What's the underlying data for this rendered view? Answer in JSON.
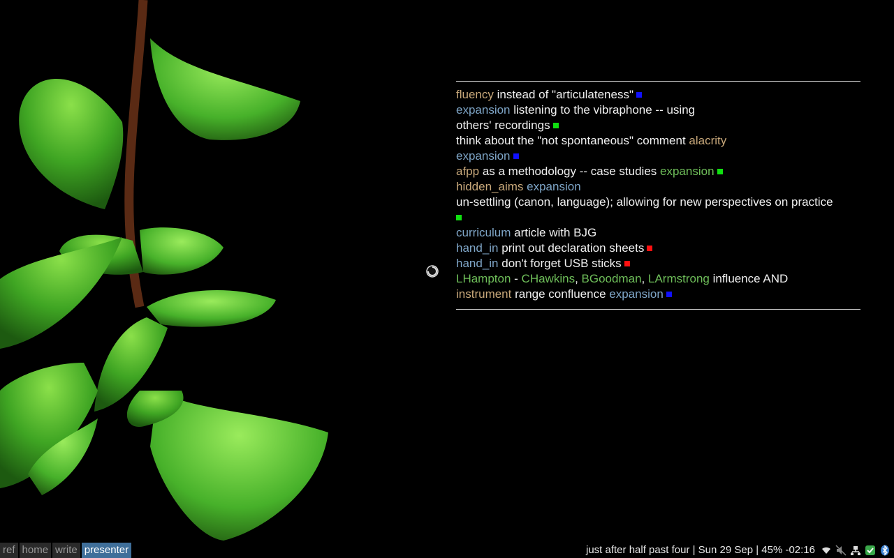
{
  "notes": [
    [
      {
        "t": "fluency",
        "c": "tag-tan"
      },
      {
        "t": " instead of \"articulateness\"",
        "c": "plain"
      },
      {
        "sq": "blue"
      }
    ],
    [
      {
        "t": "expansion",
        "c": "tag-blue"
      },
      {
        "t": " listening to the vibraphone -- using",
        "c": "plain"
      }
    ],
    [
      {
        "t": "others' recordings",
        "c": "plain"
      },
      {
        "sq": "green"
      }
    ],
    [
      {
        "t": "think about the \"not spontaneous\" comment ",
        "c": "plain"
      },
      {
        "t": "alacrity",
        "c": "tag-tan"
      }
    ],
    [
      {
        "t": "expansion",
        "c": "tag-blue"
      },
      {
        "sq": "blue"
      }
    ],
    [
      {
        "t": "afpp",
        "c": "tag-tan"
      },
      {
        "t": " as a methodology -- case studies ",
        "c": "plain"
      },
      {
        "t": "expansion",
        "c": "tag-green"
      },
      {
        "sq": "green"
      }
    ],
    [
      {
        "t": "hidden_aims",
        "c": "tag-tan"
      },
      {
        "t": " ",
        "c": "plain"
      },
      {
        "t": "expansion",
        "c": "tag-blue"
      }
    ],
    [
      {
        "t": "un-settling (canon, language); allowing for new perspectives on practice",
        "c": "plain"
      }
    ],
    [
      {
        "sq": "green",
        "nomargin": true
      }
    ],
    [
      {
        "t": "curriculum",
        "c": "tag-blue"
      },
      {
        "t": " article with BJG",
        "c": "plain"
      }
    ],
    [
      {
        "t": "hand_in",
        "c": "tag-blue"
      },
      {
        "t": " print out declaration sheets",
        "c": "plain"
      },
      {
        "sq": "red"
      }
    ],
    [
      {
        "t": "hand_in",
        "c": "tag-blue"
      },
      {
        "t": " don't forget USB sticks",
        "c": "plain"
      },
      {
        "sq": "red"
      }
    ],
    [
      {
        "t": "LHampton",
        "c": "tag-green"
      },
      {
        "t": " - ",
        "c": "plain"
      },
      {
        "t": "CHawkins",
        "c": "tag-green"
      },
      {
        "t": ", ",
        "c": "plain"
      },
      {
        "t": "BGoodman",
        "c": "tag-green"
      },
      {
        "t": ", ",
        "c": "plain"
      },
      {
        "t": "LArmstrong",
        "c": "tag-green"
      },
      {
        "t": " influence AND",
        "c": "plain"
      }
    ],
    [
      {
        "t": "instrument",
        "c": "tag-tan"
      },
      {
        "t": " range confluence ",
        "c": "plain"
      },
      {
        "t": "expansion",
        "c": "tag-blue"
      },
      {
        "sq": "blue"
      }
    ]
  ],
  "colors": {
    "plain": "#f0f0f0",
    "tag-tan": "#c8a87a",
    "tag-blue": "#7fa6c8",
    "tag-green": "#6fbf5a",
    "blue": "#1010ff",
    "green": "#10e010",
    "red": "#ff1010",
    "workspace_active": "#3f6f9a"
  },
  "workspaces": [
    {
      "label": "ref",
      "active": false
    },
    {
      "label": "home",
      "active": false
    },
    {
      "label": "write",
      "active": false
    },
    {
      "label": "presenter",
      "active": true
    }
  ],
  "status_text": "just after half past four  | Sun 29 Sep | 45% -02:16",
  "tray_icons": [
    "wifi-icon",
    "volume-muted-icon",
    "network-icon",
    "check-shield-icon",
    "bluetooth-icon"
  ]
}
